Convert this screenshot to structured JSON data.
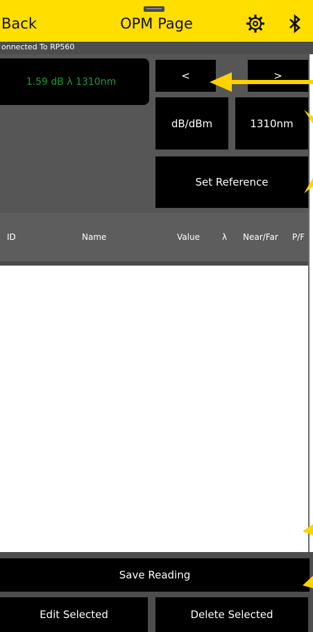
{
  "colors": {
    "accent": "#ffde00",
    "readout_text": "#1b9c35",
    "panel": "#565656"
  },
  "header": {
    "back_label": "Back",
    "title": "OPM Page",
    "settings_icon": "gear-icon",
    "bluetooth_icon": "bluetooth-icon"
  },
  "status": {
    "text": "onnected To RP560"
  },
  "readout": {
    "text": "1.59 dB λ 1310nm"
  },
  "controls": {
    "prev_label": "<",
    "next_label": ">",
    "units_label": "dB/dBm",
    "wavelength_label": "1310nm",
    "set_reference_label": "Set Reference"
  },
  "table": {
    "columns": [
      "ID",
      "Name",
      "Value",
      "λ",
      "Near/Far",
      "P/F"
    ]
  },
  "actions": {
    "save_label": "Save Reading",
    "edit_label": "Edit Selected",
    "delete_label": "Delete Selected"
  }
}
